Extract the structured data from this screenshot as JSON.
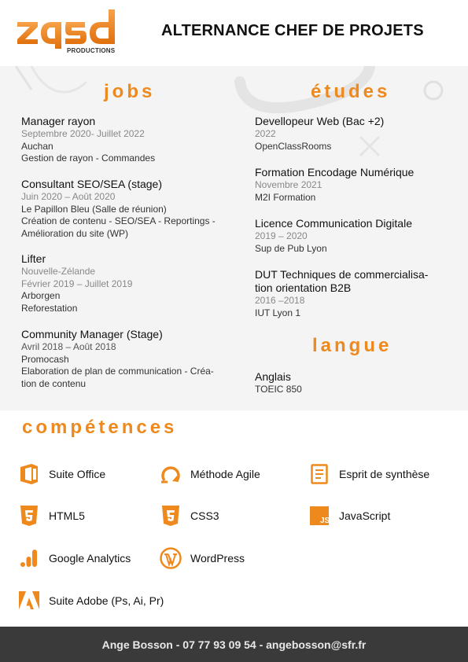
{
  "header": {
    "logo_text": "zqsd",
    "logo_sub": "PRODUCTIONS",
    "title": "ALTERNANCE CHEF DE PROJETS"
  },
  "jobs": {
    "title": "jobs",
    "items": [
      {
        "title": "Manager rayon",
        "dates": [
          "Septembre 2020- Juillet 2022"
        ],
        "lines": [
          "Auchan",
          "Gestion de rayon - Commandes"
        ]
      },
      {
        "title": "Consultant SEO/SEA (stage)",
        "dates": [
          "Juin 2020 – Août 2020"
        ],
        "lines": [
          "Le Papillon Bleu (Salle de réunion)",
          "Création de contenu - SEO/SEA - Reportings -",
          "Amélioration du site (WP)"
        ]
      },
      {
        "title": "Lifter",
        "dates": [
          "Nouvelle-Zélande",
          "Février 2019 – Juillet 2019"
        ],
        "lines": [
          "Arborgen",
          "Reforestation"
        ]
      },
      {
        "title": "Community Manager (Stage)",
        "dates": [
          "Avril 2018 – Août 2018"
        ],
        "lines": [
          "Promocash",
          "Elaboration de plan de communication - Créa-",
          "tion de contenu"
        ]
      }
    ]
  },
  "etudes": {
    "title": "études",
    "items": [
      {
        "title": [
          "Devellopeur Web (Bac +2)"
        ],
        "dates": "2022",
        "school": "OpenClassRooms"
      },
      {
        "title": [
          "Formation Encodage Numérique"
        ],
        "dates": "Novembre 2021",
        "school": "M2I Formation"
      },
      {
        "title": [
          "Licence Communication Digitale"
        ],
        "dates": "2019 – 2020",
        "school": "Sup de Pub Lyon"
      },
      {
        "title": [
          "DUT Techniques de commercialisa-",
          "tion orientation B2B"
        ],
        "dates": "2016 –2018",
        "school": "IUT Lyon 1"
      }
    ]
  },
  "langue": {
    "title": "langue",
    "items": [
      {
        "title": "Anglais",
        "detail": "TOEIC 850"
      }
    ]
  },
  "competences": {
    "title": "compétences",
    "skills": [
      {
        "label": "Suite Office",
        "icon": "office-icon"
      },
      {
        "label": "Méthode Agile",
        "icon": "agile-icon"
      },
      {
        "label": "Esprit de synthèse",
        "icon": "document-icon"
      },
      {
        "label": "HTML5",
        "icon": "html5-icon"
      },
      {
        "label": "CSS3",
        "icon": "css3-icon"
      },
      {
        "label": "JavaScript",
        "icon": "javascript-icon"
      },
      {
        "label": "Google Analytics",
        "icon": "analytics-icon"
      },
      {
        "label": "WordPress",
        "icon": "wordpress-icon"
      },
      {
        "label": "Suite Adobe (Ps, Ai, Pr)",
        "icon": "adobe-icon"
      }
    ]
  },
  "footer": {
    "contact": "Ange Bosson - 07 77 93 09 54 - angebosson@sfr.fr"
  },
  "colors": {
    "accent": "#ee8a1d",
    "footer_bg": "#3a3a3a",
    "panel_bg": "#f4f4f4"
  }
}
